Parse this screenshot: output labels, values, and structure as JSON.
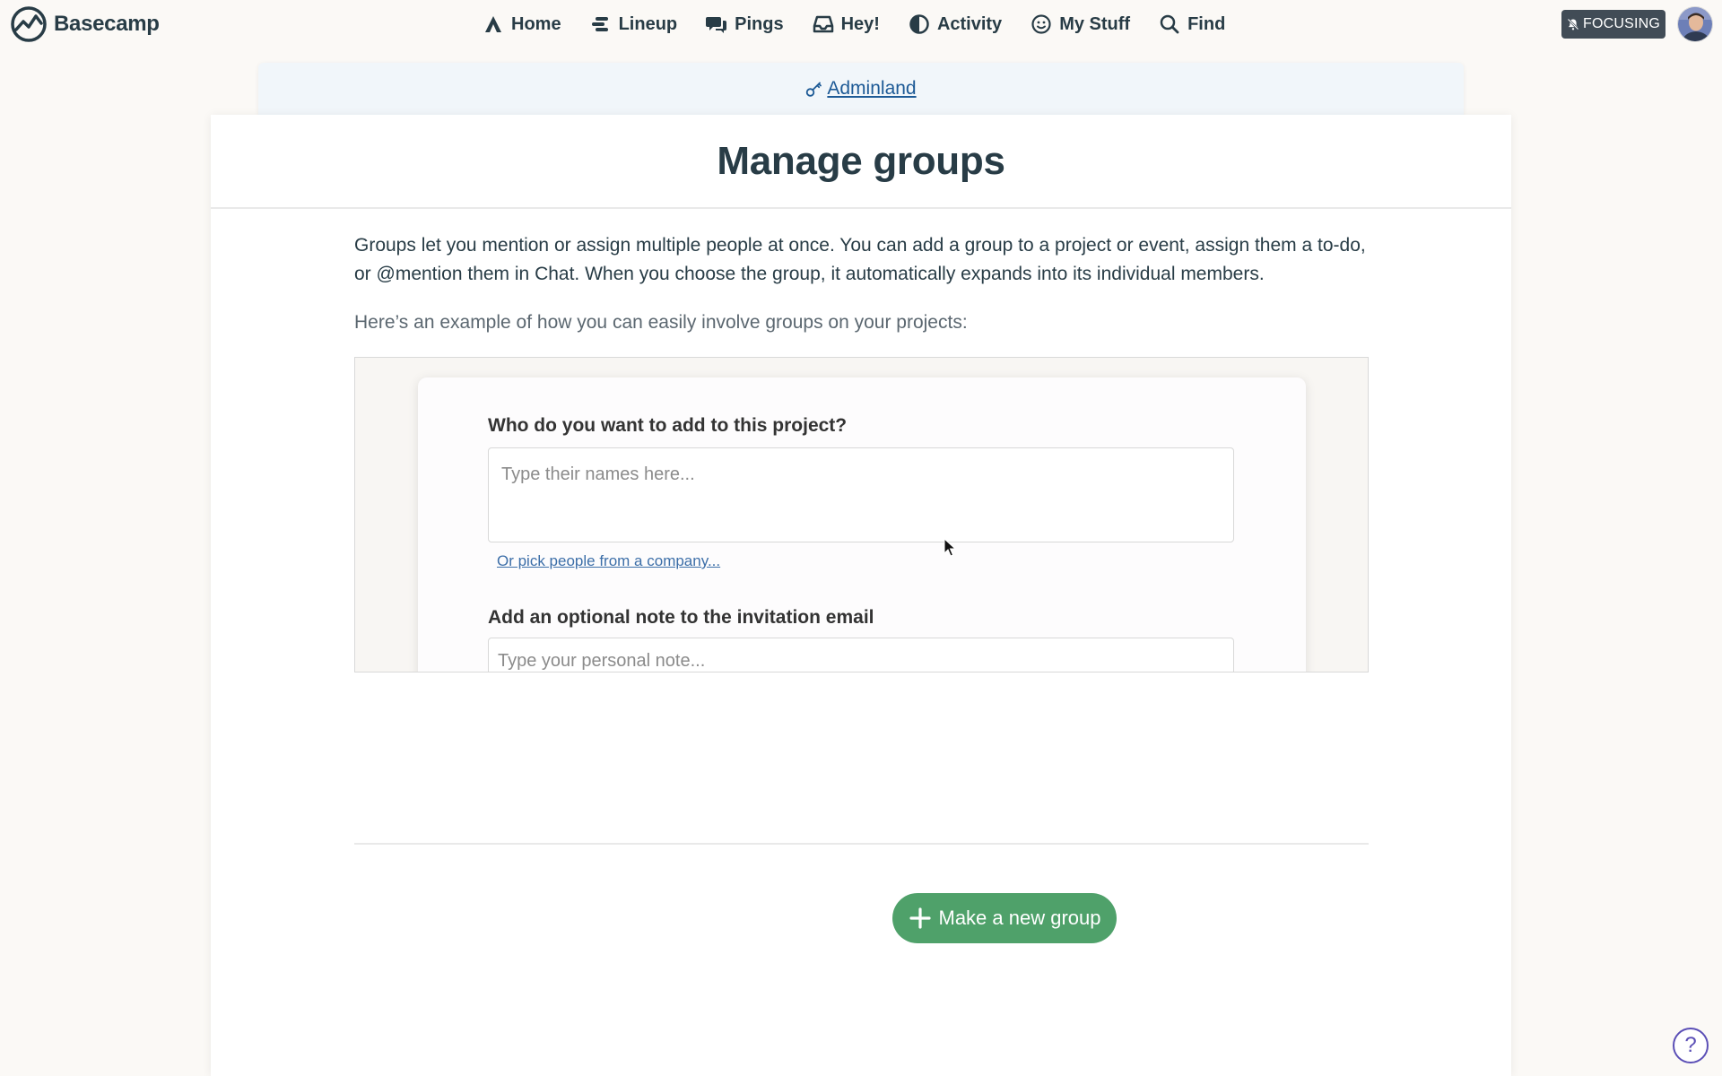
{
  "app": {
    "name": "Basecamp"
  },
  "nav": {
    "items": [
      {
        "label": "Home",
        "icon": "home-icon"
      },
      {
        "label": "Lineup",
        "icon": "lineup-icon"
      },
      {
        "label": "Pings",
        "icon": "pings-icon"
      },
      {
        "label": "Hey!",
        "icon": "inbox-icon"
      },
      {
        "label": "Activity",
        "icon": "activity-icon"
      },
      {
        "label": "My Stuff",
        "icon": "smiley-icon"
      },
      {
        "label": "Find",
        "icon": "search-icon"
      }
    ],
    "focusing_label": "FOCUSING"
  },
  "breadcrumb": {
    "adminland": "Adminland"
  },
  "page": {
    "title": "Manage groups",
    "intro": "Groups let you mention or assign multiple people at once. You can add a group to a project or event, assign them a to-do, or @mention them in Chat. When you choose the group, it automatically expands into its individual members.",
    "example_intro": "Here’s an example of how you can easily involve groups on your projects:"
  },
  "example": {
    "question": "Who do you want to add to this project?",
    "names_placeholder": "Type their names here...",
    "pick_link": "Or pick people from a company...",
    "note_label": "Add an optional note to the invitation email",
    "note_placeholder": "Type your personal note..."
  },
  "actions": {
    "new_group": "Make a new group"
  },
  "help": {
    "label": "?"
  },
  "colors": {
    "background": "#fbf9f6",
    "link": "#1d5a96",
    "primary_button": "#4fa16a",
    "focusing_badge": "#414c56",
    "help": "#5b4fb6"
  }
}
